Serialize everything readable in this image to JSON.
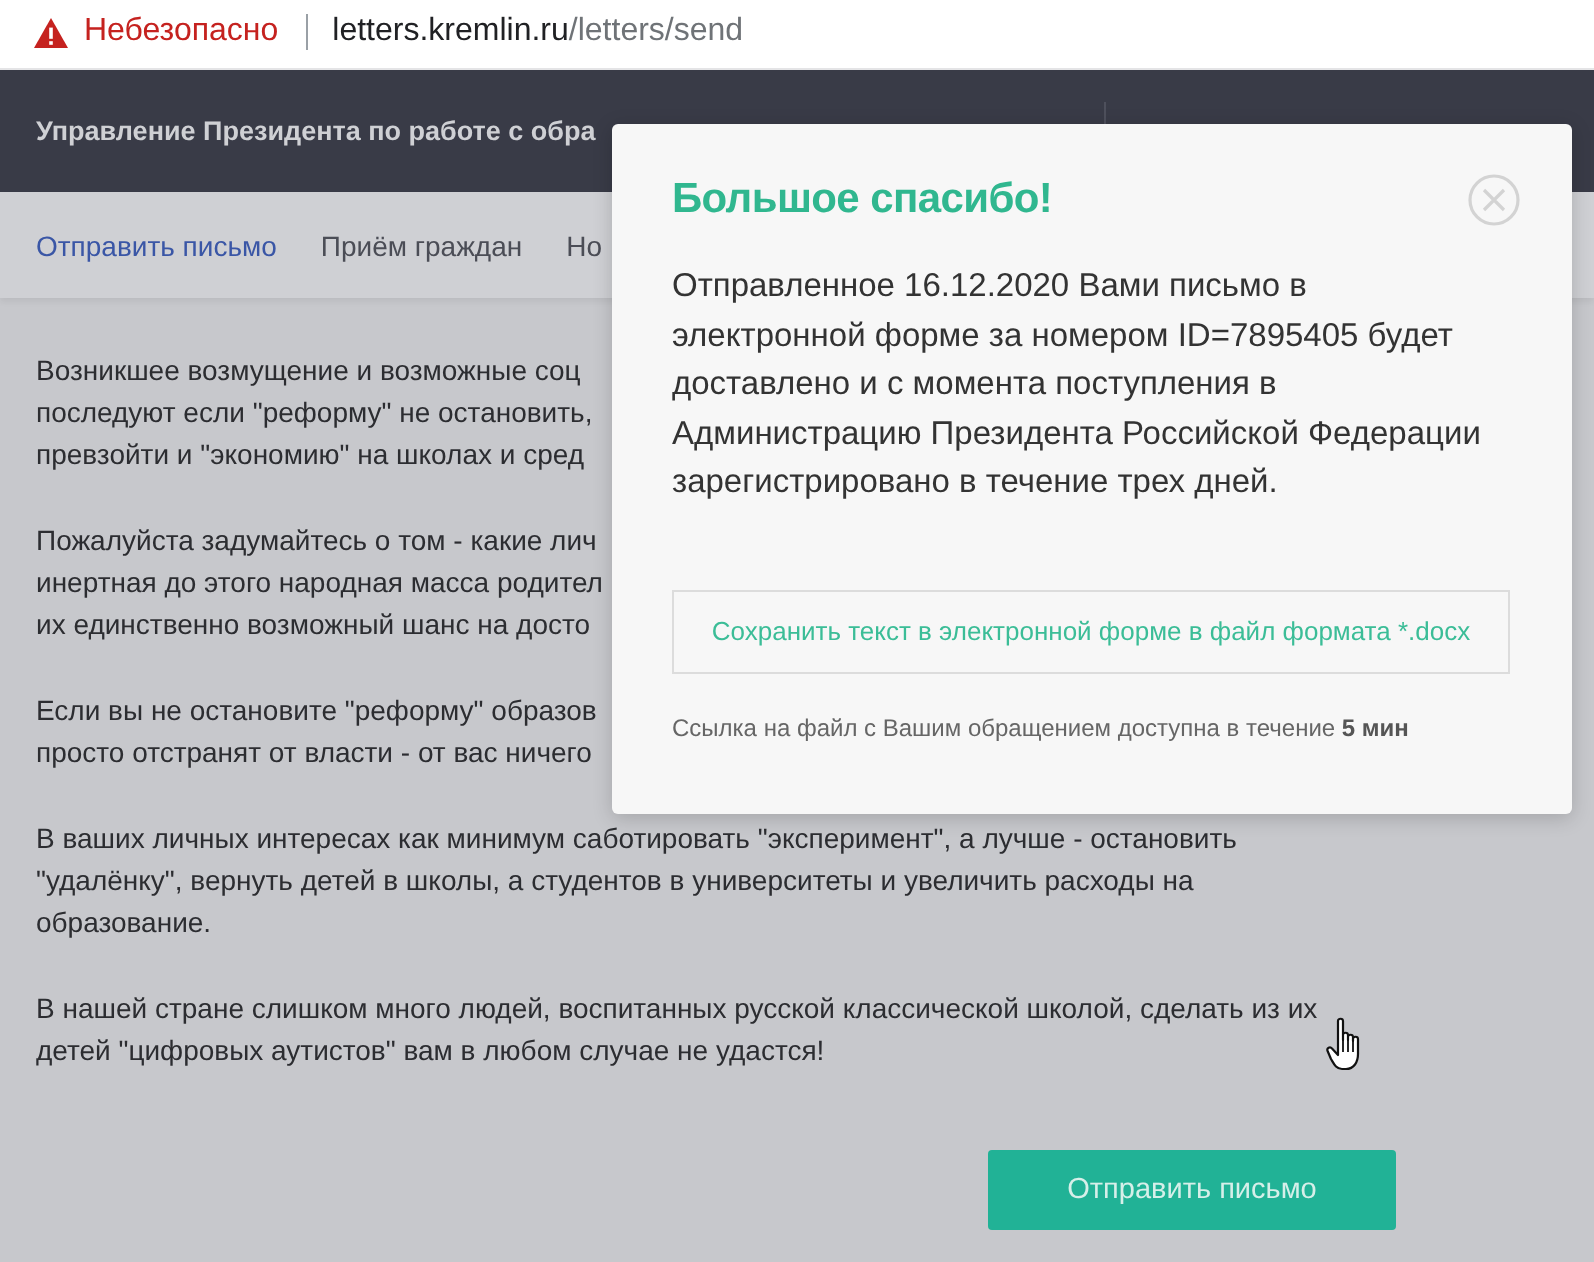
{
  "browser": {
    "security_label": "Небезопасно",
    "url_host": "letters.kremlin.ru",
    "url_path": "/letters/send"
  },
  "header": {
    "title": "Управление Президента по работе с обра"
  },
  "nav": {
    "tabs": [
      {
        "label": "Отправить письмо",
        "selected": true
      },
      {
        "label": "Приём граждан",
        "selected": false
      },
      {
        "label": "Но",
        "selected": false
      }
    ]
  },
  "content": {
    "paragraphs": [
      {
        "lines": [
          "Возникшее возмущение и возможные соц",
          "последуют если \"реформу\" не остановить,",
          "превзойти и \"экономию\" на школах и сред"
        ]
      },
      {
        "lines": [
          "Пожалуйста задумайтесь о том - какие лич",
          "инертная до этого народная масса родител",
          "их единственно возможный шанс на досто"
        ]
      },
      {
        "lines": [
          "Если вы не остановите \"реформу\" образов",
          "просто отстранят от власти - от вас ничего"
        ]
      },
      {
        "lines": [
          "В ваших личных интересах как минимум саботировать \"эксперимент\", а лучше - остановить",
          "\"удалёнку\", вернуть детей в школы, а студентов в университеты и увеличить расходы на",
          "образование."
        ]
      },
      {
        "lines": [
          "В нашей стране слишком много людей, воспитанных русской классической школой, сделать из их",
          "детей \"цифровых аутистов\" вам в любом случае не удастся!"
        ]
      }
    ],
    "submit_button": "Отправить письмо"
  },
  "modal": {
    "title": "Большое спасибо!",
    "message": "Отправленное 16.12.2020 Вами письмо в электронной форме за номером ID=7895405 будет доставлено и с момента поступления в Администрацию Президента Российской Федерации зарегистрировано в течение трех дней.",
    "download_button": "Сохранить текст в электронной форме в файл формата *.docx",
    "note": "Ссылка на файл с Вашим обращением доступна в течение **5 мин**"
  }
}
